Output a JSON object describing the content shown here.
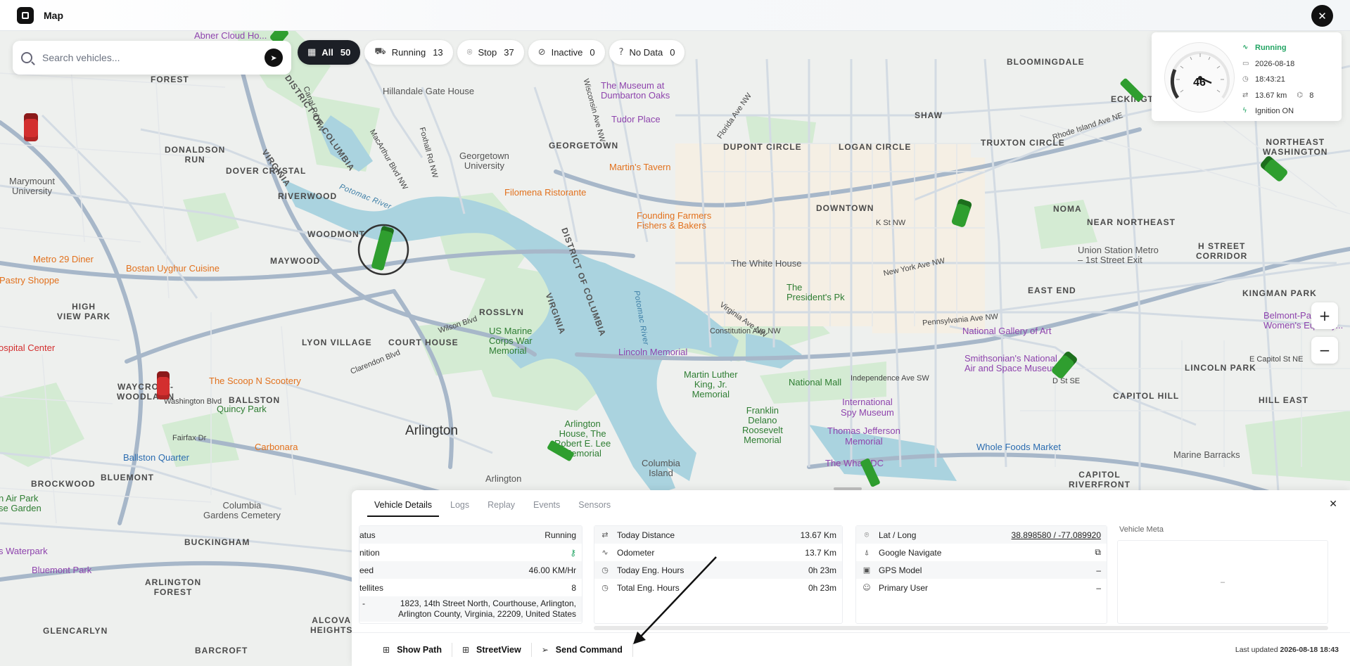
{
  "app": {
    "title": "Map",
    "close_icon": "close-icon"
  },
  "search": {
    "placeholder": "Search vehicles...",
    "value": ""
  },
  "filters": [
    {
      "label": "All",
      "count": "50",
      "icon": "grid-icon",
      "active": true
    },
    {
      "label": "Running",
      "count": "13",
      "icon": "car-icon",
      "active": false
    },
    {
      "label": "Stop",
      "count": "37",
      "icon": "pin-icon",
      "active": false
    },
    {
      "label": "Inactive",
      "count": "0",
      "icon": "no-signal-icon",
      "active": false
    },
    {
      "label": "No Data",
      "count": "0",
      "icon": "question-icon",
      "active": false
    }
  ],
  "speed_card": {
    "speed": "46",
    "status": "Running",
    "date": "2026-08-18",
    "time": "18:43:21",
    "distance": "13.67 km",
    "satellites": "8",
    "ignition": "Ignition ON"
  },
  "map_labels": {
    "forest": "FOREST",
    "donaldson_run": "DONALDSON\nRUN",
    "dover_crystal": "DOVER CRYSTAL",
    "riverwood": "RIVERWOOD",
    "woodmont": "WOODMONT",
    "maywood": "MAYWOOD",
    "high_view_park": "HIGH\nVIEW PARK",
    "lyon_village": "LYON VILLAGE",
    "court_house": "COURT HOUSE",
    "rosslyn": "ROSSLYN",
    "waycroft": "WAYCROFT-\nWOODLAWN",
    "ballston": "BALLSTON",
    "bluemont": "BLUEMONT",
    "brockwood": "BROCKWOOD",
    "buckingham": "BUCKINGHAM",
    "arlington_forest": "ARLINGTON\nFOREST",
    "alcova": "ALCOVA\nHEIGHTS",
    "glencarlyn": "GLENCARLYN",
    "barcroft": "BARCROFT",
    "arlington": "Arlington",
    "georgetown": "GEORGETOWN",
    "dupont": "DUPONT CIRCLE",
    "logan": "LOGAN CIRCLE",
    "shaw": "SHAW",
    "truxton": "TRUXTON CIRCLE",
    "bloomingdale": "BLOOMINGDALE",
    "eckington": "ECKINGTON",
    "ne_washington": "NORTHEAST\nWASHINGTON",
    "noma": "NOMA",
    "near_ne": "NEAR NORTHEAST",
    "h_street": "H STREET\nCORRIDOR",
    "downtown": "DOWNTOWN",
    "east_end": "EAST END",
    "kingman": "KINGMAN PARK",
    "lincoln_park": "LINCOLN PARK",
    "capitol_hill": "CAPITOL HILL",
    "hill_east": "HILL EAST",
    "capitol_riverfront": "CAPITOL\nRIVERFRONT",
    "dc_district": "DISTRICT OF COLUMBIA",
    "virginia": "VIRGINIA",
    "potomac": "Potomac River",
    "columbia_island": "Columbia\nIsland",
    "abner": "Abner Cloud Ho...",
    "marymount": "Marymount\nUniversity",
    "hillandale": "Hillandale Gate House",
    "georgetown_u": "Georgetown\nUniversity",
    "museum_dumbarton": "The Museum at\nDumbarton Oaks",
    "tudor": "Tudor Place",
    "martins": "Martin's Tavern",
    "filomena": "Filomena Ristorante",
    "founding": "Founding Farmers\nFishers & Bakers",
    "metro29": "Metro 29 Diner",
    "pastry": "Pastry Shoppe",
    "bostan": "Bostan Uyghur Cuisine",
    "hospital": "ospital Center",
    "scoop": "The Scoop N Scootery",
    "quincy": "Quincy Park",
    "carbonara": "Carbonara",
    "ballston_quarter": "Ballston Quarter",
    "us_marine": "US Marine\nCorps War\nMemorial",
    "arlington_house": "Arlington\nHouse, The\nRobert E. Lee\nMemorial",
    "arlington_cem": "Arlington",
    "columbia_gardens": "Columbia\nGardens Cemetery",
    "air_park": "n Air Park\nse Garden",
    "waterpark": "s Waterpark",
    "bluemont_park": "Bluemont Park",
    "white_house": "The White House",
    "presidents_pk": "The\nPresident's Pk",
    "lincoln_mem": "Lincoln Memorial",
    "mlk": "Martin Luther\nKing, Jr.\nMemorial",
    "national_mall": "National Mall",
    "fdr": "Franklin\nDelano\nRoosevelt\nMemorial",
    "spy": "International\nSpy Museum",
    "jefferson": "Thomas Jefferson\nMemorial",
    "wharf": "The Wharf DC",
    "union_station": "Union Station Metro\n– 1st Street Exit",
    "nga": "National Gallery of Art",
    "smithsonian": "Smithsonian's National\nAir and Space Museum",
    "belmont": "Belmont-Paul\nWomen's Equality...",
    "whole_foods": "Whole Foods Market",
    "marine_barracks": "Marine Barracks",
    "constitution": "Constitution Ave NW",
    "independence": "Independence Ave SW",
    "penn": "Pennsylvania Ave NW",
    "ny_ave": "New York Ave NW",
    "k_st": "K St NW",
    "rhode": "Rhode Island Ave NE",
    "ecap": "E Capitol St NE",
    "dst": "D St SE",
    "wilson": "Wilson Blvd",
    "clarendon": "Clarendon Blvd",
    "washington_blvd": "Washington Blvd",
    "fairfax": "Fairfax Dr",
    "canal": "Canal Rd NW",
    "macarthur": "MacArthur Blvd NW",
    "foxhall": "Foxhall Rd NW",
    "wisconsin": "Wisconsin Ave NW",
    "florida": "Florida Ave NW",
    "virginia_ave": "Virginia Ave NW"
  },
  "panel": {
    "tabs": [
      "Vehicle Details",
      "Logs",
      "Replay",
      "Events",
      "Sensors"
    ],
    "status_rows": [
      {
        "key": "atus",
        "value": "Running"
      },
      {
        "key": "nition",
        "value": ""
      },
      {
        "key": "eed",
        "value": "46.00 KM/Hr"
      },
      {
        "key": "tellites",
        "value": "8"
      }
    ],
    "address_dash": "-",
    "address": "1823, 14th Street North, Courthouse, Arlington,\nArlington County, Virginia, 22209, United States",
    "distance_rows": [
      {
        "key": "Today Distance",
        "value": "13.67 Km",
        "icon": "route-icon"
      },
      {
        "key": "Odometer",
        "value": "13.7 Km",
        "icon": "activity-icon"
      },
      {
        "key": "Today Eng. Hours",
        "value": "0h 23m",
        "icon": "clock-icon"
      },
      {
        "key": "Total Eng. Hours",
        "value": "0h 23m",
        "icon": "clock-icon"
      }
    ],
    "info_rows": [
      {
        "key": "Lat / Long",
        "value": "38.898580 / -77.089920",
        "icon": "pin-icon"
      },
      {
        "key": "Google Navigate",
        "value": "",
        "icon": "navigate-icon"
      },
      {
        "key": "GPS Model",
        "value": "–",
        "icon": "chip-icon"
      },
      {
        "key": "Primary User",
        "value": "–",
        "icon": "user-icon"
      }
    ],
    "meta_title": "Vehicle Meta",
    "meta_value": "–",
    "actions": [
      {
        "label": "Show Path",
        "icon": "plus-square-icon"
      },
      {
        "label": "StreetView",
        "icon": "plus-square-icon"
      },
      {
        "label": "Send Command",
        "icon": "send-icon"
      }
    ],
    "updated_label": "Last updated",
    "updated_value": "2026-08-18 18:43"
  },
  "colors": {
    "running": "#22a463",
    "stopped": "#d32f2f",
    "water": "#aad3df",
    "park": "#cfe8d0"
  }
}
